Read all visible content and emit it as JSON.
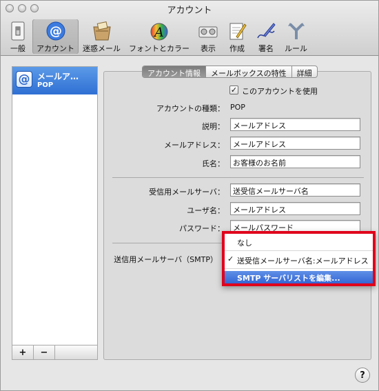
{
  "window": {
    "title": "アカウント"
  },
  "toolbar": {
    "items": [
      {
        "label": "一般"
      },
      {
        "label": "アカウント"
      },
      {
        "label": "迷惑メール"
      },
      {
        "label": "フォントとカラー"
      },
      {
        "label": "表示"
      },
      {
        "label": "作成"
      },
      {
        "label": "署名"
      },
      {
        "label": "ルール"
      }
    ],
    "selected_index": 1
  },
  "sidebar": {
    "accounts": [
      {
        "name": "メールア…",
        "type": "POP",
        "icon": "at-icon"
      }
    ],
    "add_label": "+",
    "remove_label": "−"
  },
  "tabs": {
    "items": [
      "アカウント情報",
      "メールボックスの特性",
      "詳細"
    ],
    "selected_index": 0
  },
  "form": {
    "enable_checkbox": {
      "label": "このアカウントを使用",
      "checked": true,
      "mark": "✓"
    },
    "account_type": {
      "label": "アカウントの種類：",
      "value": "POP"
    },
    "description": {
      "label": "説明：",
      "value": "メールアドレス"
    },
    "email": {
      "label": "メールアドレス：",
      "value": "メールアドレス"
    },
    "full_name": {
      "label": "氏名：",
      "value": "お客様のお名前"
    },
    "incoming_server": {
      "label": "受信用メールサーバ：",
      "value": "送受信メールサーバ名"
    },
    "username": {
      "label": "ユーザ名：",
      "value": "メールアドレス"
    },
    "password": {
      "label": "パスワード：",
      "value": "メールパスワード"
    },
    "smtp_server": {
      "label": "送信用メールサーバ（SMTP）"
    }
  },
  "smtp_menu": {
    "items": [
      {
        "label": "なし",
        "checked": false
      },
      {
        "label": "送受信メールサーバ名:メールアドレス",
        "checked": true
      },
      {
        "label": "SMTP サーバリストを編集...",
        "highlighted": true
      }
    ],
    "check_mark": "✓",
    "highlight_border_color": "#e0001b"
  },
  "help_label": "?"
}
